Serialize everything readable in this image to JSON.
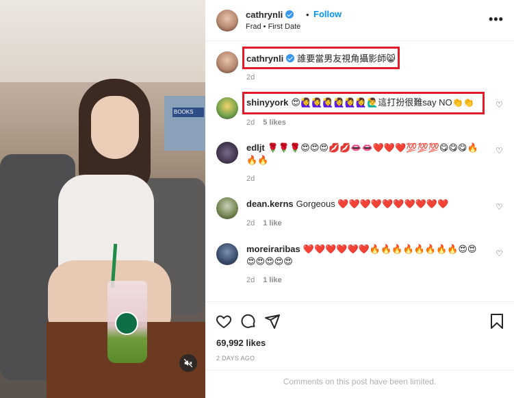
{
  "header": {
    "username": "cathrynli",
    "separator": "•",
    "follow_label": "Follow",
    "subtitle": "Frad • First Date",
    "more_label": "•••"
  },
  "caption": {
    "username": "cathrynli",
    "text": "誰要當男友視角攝影師😸",
    "time": "2d"
  },
  "comments": [
    {
      "username": "shinyyork",
      "text": "😍🙋‍♀️🙋‍♀️🙋‍♀️🙋‍♀️🙋‍♀️🙋‍♀️🙋‍♂️這打扮很難say NO👏👏",
      "time": "2d",
      "likes": "5 likes"
    },
    {
      "username": "edljt",
      "text": "🌹🌹🌹😍😍😍💋💋👄👄❤️❤️❤️💯💯💯😋😋😋🔥🔥🔥",
      "time": "2d",
      "likes": ""
    },
    {
      "username": "dean.kerns",
      "text": "Gorgeous ❤️❤️❤️❤️❤️❤️❤️❤️❤️❤️",
      "time": "2d",
      "likes": "1 like"
    },
    {
      "username": "moreiraribas",
      "text": "❤️❤️❤️❤️❤️❤️🔥🔥🔥🔥🔥🔥🔥🔥😍😍😍😍😍😍😍",
      "time": "2d",
      "likes": "1 like"
    }
  ],
  "post": {
    "likes": "69,992 likes",
    "date": "2 DAYS AGO",
    "comments_limited": "Comments on this post have been limited."
  },
  "photo_overlay": {
    "store_sign": "BOOKS"
  },
  "icons": {
    "heart": "heart-icon",
    "comment": "comment-icon",
    "share": "share-icon",
    "save": "bookmark-icon",
    "mute": "speaker-muted-icon"
  },
  "colors": {
    "accent": "#0095f6",
    "verified": "#3897f0",
    "highlight": "#e21a2c",
    "muted_text": "#8e8e8e"
  }
}
